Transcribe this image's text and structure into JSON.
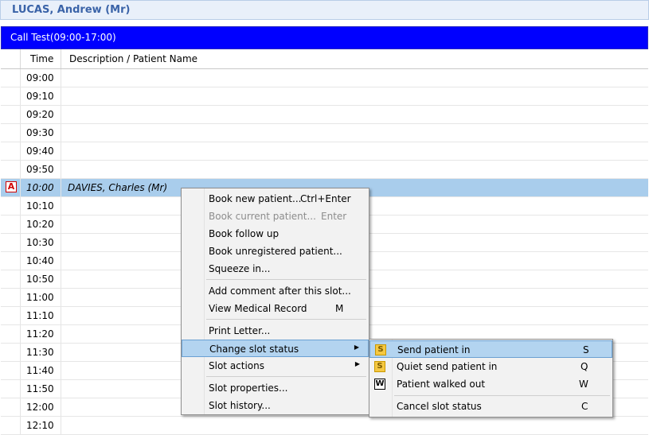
{
  "header": {
    "patient_name": "LUCAS, Andrew (Mr)"
  },
  "session": {
    "title": "Call Test(09:00-17:00)"
  },
  "columns": {
    "time": "Time",
    "description": "Description / Patient Name"
  },
  "slots": [
    {
      "time": "09:00",
      "desc": ""
    },
    {
      "time": "09:10",
      "desc": ""
    },
    {
      "time": "09:20",
      "desc": ""
    },
    {
      "time": "09:30",
      "desc": ""
    },
    {
      "time": "09:40",
      "desc": ""
    },
    {
      "time": "09:50",
      "desc": ""
    },
    {
      "time": "10:00",
      "desc": "DAVIES, Charles (Mr)",
      "marker": "A"
    },
    {
      "time": "10:10",
      "desc": ""
    },
    {
      "time": "10:20",
      "desc": ""
    },
    {
      "time": "10:30",
      "desc": ""
    },
    {
      "time": "10:40",
      "desc": ""
    },
    {
      "time": "10:50",
      "desc": ""
    },
    {
      "time": "11:00",
      "desc": ""
    },
    {
      "time": "11:10",
      "desc": ""
    },
    {
      "time": "11:20",
      "desc": ""
    },
    {
      "time": "11:30",
      "desc": ""
    },
    {
      "time": "11:40",
      "desc": ""
    },
    {
      "time": "11:50",
      "desc": ""
    },
    {
      "time": "12:00",
      "desc": ""
    },
    {
      "time": "12:10",
      "desc": ""
    }
  ],
  "context_menu": {
    "book_new": {
      "label": "Book new patient...",
      "shortcut": "Ctrl+Enter"
    },
    "book_current": {
      "label": "Book current patient...",
      "shortcut": "Enter"
    },
    "book_follow_up": {
      "label": "Book follow up"
    },
    "book_unregistered": {
      "label": "Book unregistered patient..."
    },
    "squeeze_in": {
      "label": "Squeeze in..."
    },
    "add_comment": {
      "label": "Add comment after this slot..."
    },
    "view_medical_record": {
      "label": "View Medical Record",
      "shortcut": "M"
    },
    "print_letter": {
      "label": "Print Letter..."
    },
    "change_slot_status": {
      "label": "Change slot status"
    },
    "slot_actions": {
      "label": "Slot actions"
    },
    "slot_properties": {
      "label": "Slot properties..."
    },
    "slot_history": {
      "label": "Slot history..."
    }
  },
  "submenu": {
    "send_patient_in": {
      "label": "Send patient in",
      "shortcut": "S",
      "icon": "S"
    },
    "quiet_send_patient_in": {
      "label": "Quiet send patient in",
      "shortcut": "Q",
      "icon": "S"
    },
    "patient_walked_out": {
      "label": "Patient walked out",
      "shortcut": "W",
      "icon": "W"
    },
    "cancel_slot_status": {
      "label": "Cancel slot status",
      "shortcut": "C"
    }
  }
}
